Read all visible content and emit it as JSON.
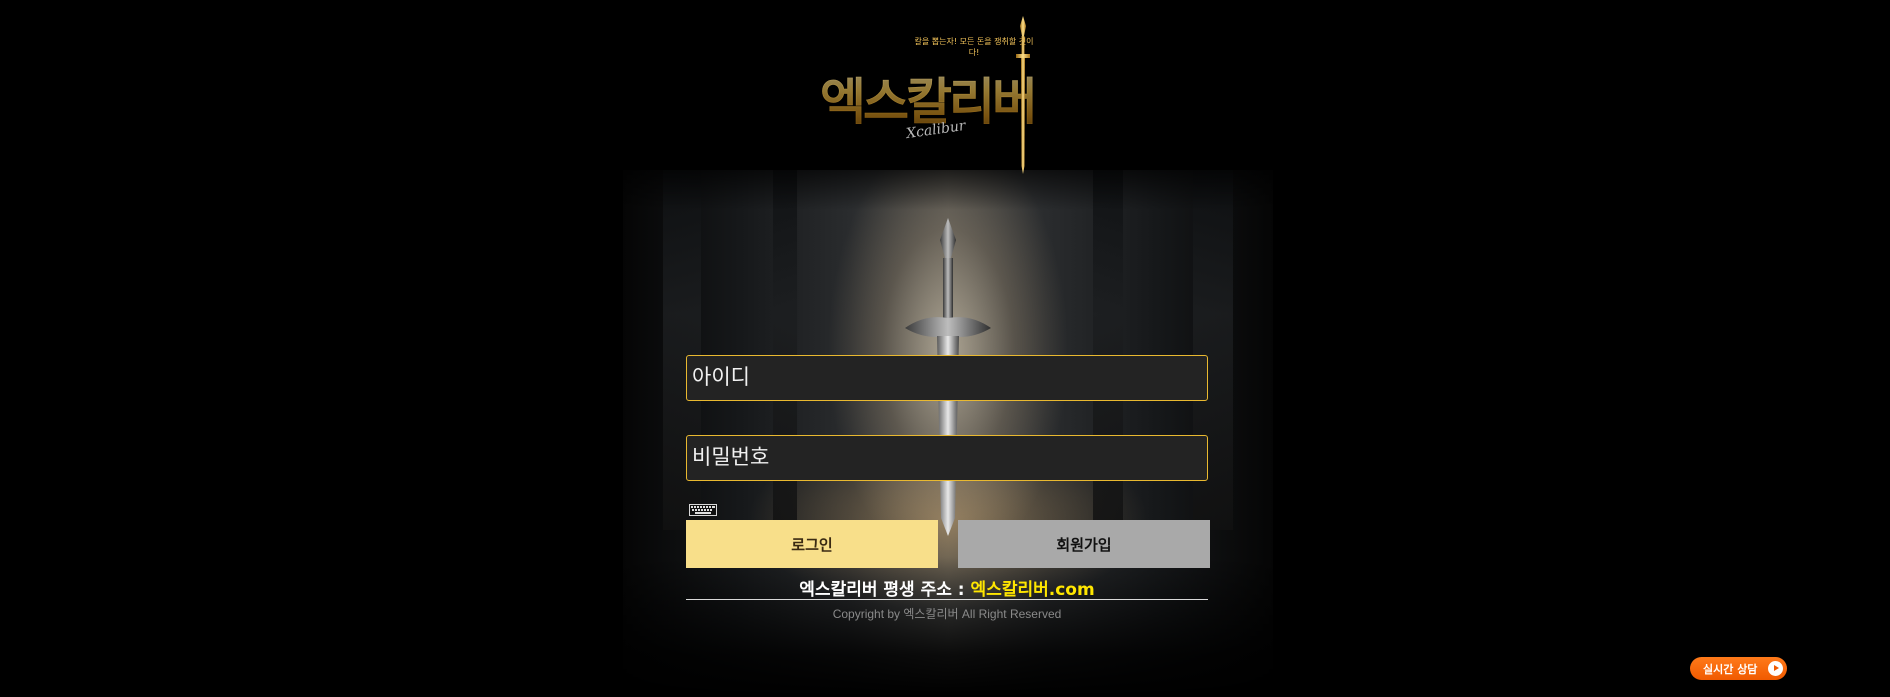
{
  "logo": {
    "tagline": "칼을 뽑는자! 모든 돈을 쟁취할 것이다!",
    "title": "엑스칼리버",
    "subtitle": "Xcalibur"
  },
  "login": {
    "id_placeholder": "아이디",
    "password_placeholder": "비밀번호",
    "login_label": "로그인",
    "signup_label": "회원가입"
  },
  "footer": {
    "address_prefix": "엑스칼리버 평생 주소 :",
    "address_url": "엑스칼리버.com",
    "copyright": "Copyright by 엑스칼리버 All Right Reserved"
  },
  "chat": {
    "label": "실시간 상담"
  },
  "colors": {
    "accent_gold": "#e9b930",
    "login_button": "#f8df8a",
    "signup_button": "#a9a9a9",
    "address_highlight": "#ffe600",
    "chat_button": "#f05a00"
  },
  "icons": {
    "keyboard": "keyboard-icon",
    "chat_arrow": "play-arrow-icon"
  }
}
